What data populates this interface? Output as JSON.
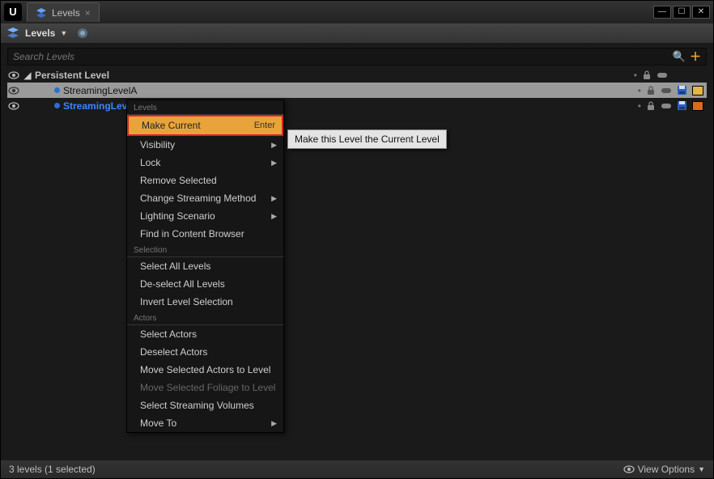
{
  "titlebar": {
    "tab_label": "Levels"
  },
  "toolbar": {
    "title": "Levels"
  },
  "search": {
    "placeholder": "Search Levels"
  },
  "levels": [
    {
      "name": "Persistent Level"
    },
    {
      "name": "StreamingLevelA"
    },
    {
      "name": "StreamingLevelB"
    }
  ],
  "ctx": {
    "sec_levels": "Levels",
    "make_current": "Make Current",
    "make_current_key": "Enter",
    "visibility": "Visibility",
    "lock": "Lock",
    "remove_selected": "Remove Selected",
    "change_streaming": "Change Streaming Method",
    "lighting_scenario": "Lighting Scenario",
    "find_browser": "Find in Content Browser",
    "sec_selection": "Selection",
    "select_all": "Select All Levels",
    "deselect_all": "De-select All Levels",
    "invert_sel": "Invert Level Selection",
    "sec_actors": "Actors",
    "select_actors": "Select Actors",
    "deselect_actors": "Deselect Actors",
    "move_sel_actors": "Move Selected Actors to Level",
    "move_sel_foliage": "Move Selected Foliage to Level",
    "select_streaming": "Select Streaming Volumes",
    "move_to": "Move To"
  },
  "tooltip": "Make this Level the Current Level",
  "status": {
    "left": "3 levels (1 selected)",
    "right": "View Options"
  }
}
